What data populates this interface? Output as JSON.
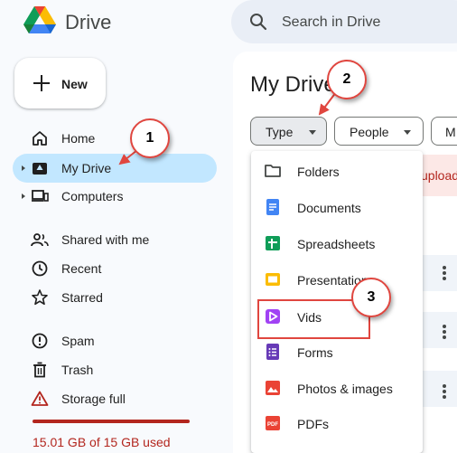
{
  "header": {
    "app_title": "Drive",
    "search_placeholder": "Search in Drive",
    "logo_icon": "google-drive-logo",
    "search_icon": "search-icon"
  },
  "new_button": {
    "label": "New",
    "icon": "plus-icon"
  },
  "sidebar": {
    "items": [
      {
        "label": "Home",
        "icon": "home-icon",
        "active": false,
        "expandable": false
      },
      {
        "label": "My Drive",
        "icon": "my-drive-icon",
        "active": true,
        "expandable": true
      },
      {
        "label": "Computers",
        "icon": "computers-icon",
        "active": false,
        "expandable": true
      },
      {
        "label": "Shared with me",
        "icon": "shared-people-icon",
        "active": false,
        "expandable": false
      },
      {
        "label": "Recent",
        "icon": "clock-icon",
        "active": false,
        "expandable": false
      },
      {
        "label": "Starred",
        "icon": "star-icon",
        "active": false,
        "expandable": false
      },
      {
        "label": "Spam",
        "icon": "spam-icon",
        "active": false,
        "expandable": false
      },
      {
        "label": "Trash",
        "icon": "trash-icon",
        "active": false,
        "expandable": false
      },
      {
        "label": "Storage full",
        "icon": "warning-icon",
        "active": false,
        "expandable": false
      }
    ],
    "storage_text": "15.01 GB of 15 GB used",
    "storage_fraction": 1.0
  },
  "main": {
    "title": "My Drive",
    "filters": [
      {
        "label": "Type"
      },
      {
        "label": "People"
      },
      {
        "label": "M"
      }
    ],
    "upload_banner_text": "upload"
  },
  "type_menu": {
    "items": [
      {
        "label": "Folders",
        "icon": "folder-icon"
      },
      {
        "label": "Documents",
        "icon": "docs-icon"
      },
      {
        "label": "Spreadsheets",
        "icon": "sheets-icon"
      },
      {
        "label": "Presentations",
        "icon": "slides-icon"
      },
      {
        "label": "Vids",
        "icon": "vids-icon"
      },
      {
        "label": "Forms",
        "icon": "forms-icon"
      },
      {
        "label": "Photos & images",
        "icon": "image-icon"
      },
      {
        "label": "PDFs",
        "icon": "pdf-icon"
      }
    ]
  },
  "annotations": {
    "step1": "1",
    "step2": "2",
    "step3": "3"
  },
  "colors": {
    "accent": "#c2e7ff",
    "warning": "#b3261e",
    "annotation": "#e0463f",
    "background": "#f8fafd"
  }
}
